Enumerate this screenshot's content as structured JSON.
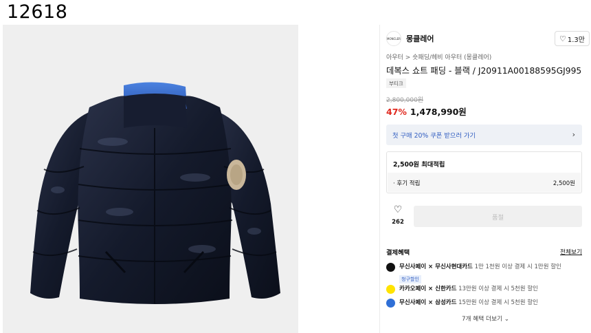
{
  "page_id": "12618",
  "brand": {
    "name": "몽클레어",
    "logo_text": "MONCLER",
    "like_count": "1.3만"
  },
  "breadcrumb": {
    "items": [
      "아우터",
      "숏패딩/헤비 아우터 (몽클레어)"
    ],
    "separator": ">"
  },
  "product": {
    "title": "데복스 쇼트 패딩 - 블랙 / J20911A00188595GJ995",
    "tag": "부티크",
    "original_price": "2,800,000원",
    "discount": "47%",
    "sale_price": "1,478,990원"
  },
  "coupon": {
    "label": "첫 구매 20% 쿠폰 받으러 가기",
    "chevron": "›"
  },
  "points": {
    "headline": "2,500원 최대적립",
    "rows": [
      {
        "label": "· 후기 적립",
        "value": "2,500원"
      }
    ]
  },
  "actions": {
    "wish_count": "262",
    "buy_label": "품절"
  },
  "benefits": {
    "title": "결제혜택",
    "see_all": "전체보기",
    "items": [
      {
        "icon": "musinsa-pay-icon",
        "icon_color": "#111111",
        "strong": "무신사페이 × 무신사현대카드",
        "detail": "1만 1천원 이상 결제 시 1만원 할인",
        "badge": "청구할인"
      },
      {
        "icon": "kakaopay-icon",
        "icon_color": "#ffe300",
        "strong": "카카오페이 × 신한카드",
        "detail": "13만원 이상 결제 시 5천원 할인",
        "badge": ""
      },
      {
        "icon": "samsung-card-icon",
        "icon_color": "#2f6fd6",
        "strong": "무신사페이 × 삼성카드",
        "detail": "15만원 이상 결제 시 5천원 할인",
        "badge": ""
      }
    ],
    "more_label": "7개 혜택 더보기"
  },
  "colors": {
    "discount_red": "#e0291f",
    "link_blue": "#2f5cc0",
    "jacket_navy": "#141a2b",
    "collar_blue": "#3a6fd0"
  }
}
